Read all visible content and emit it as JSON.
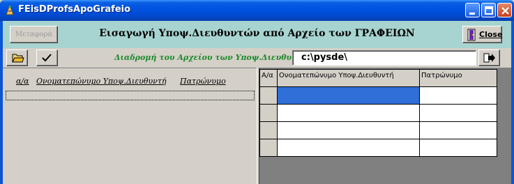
{
  "window": {
    "title": "FEisDProfsApoGrafeio"
  },
  "header": {
    "transfer_label": "Μεταφορά",
    "title": "Εισαγωγή Υποψ.Διευθυντών από Αρχείο των ΓΡΑΦΕΙΩΝ",
    "close_label": "Close"
  },
  "toolbar": {
    "path_label": "Διαδρομή του Αρχείου των Υποψ.Διευθυντών",
    "path_value": "c:\\pysde\\"
  },
  "left": {
    "columns": [
      "α/α",
      "Ονοματεπώνυμο Υποψ.Διευθυντή",
      "Πατρώνυμο"
    ]
  },
  "grid": {
    "columns": [
      "Α/α",
      "Ονοματεπώνυμο Υποψ.Διευθυντή",
      "Πατρώνυμο"
    ],
    "rows": 4,
    "selected_color": "#2f6fd7"
  }
}
